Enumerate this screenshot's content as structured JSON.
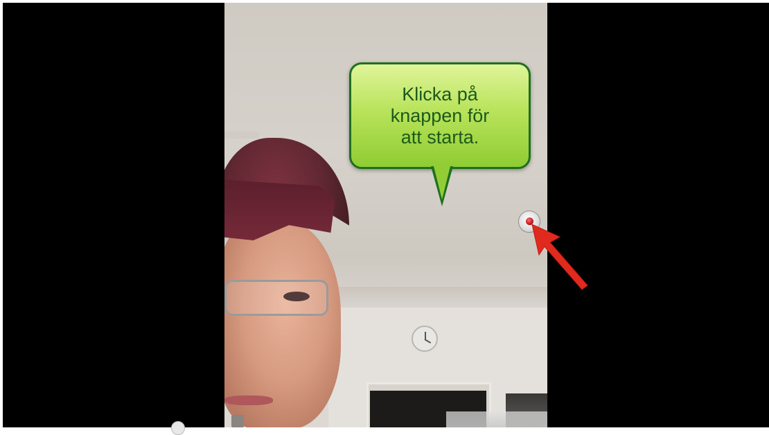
{
  "tooltip": {
    "lines": [
      "Klicka på",
      "knappen för",
      "att starta."
    ]
  },
  "icons": {
    "record": "record-dot-icon",
    "arrow": "red-arrow-icon"
  },
  "colors": {
    "bubble_fill": "#b9e35b",
    "bubble_border": "#1f6f1f",
    "bubble_text": "#1c5a1c",
    "arrow": "#e02a1e",
    "record_dot": "#b10f0f"
  }
}
